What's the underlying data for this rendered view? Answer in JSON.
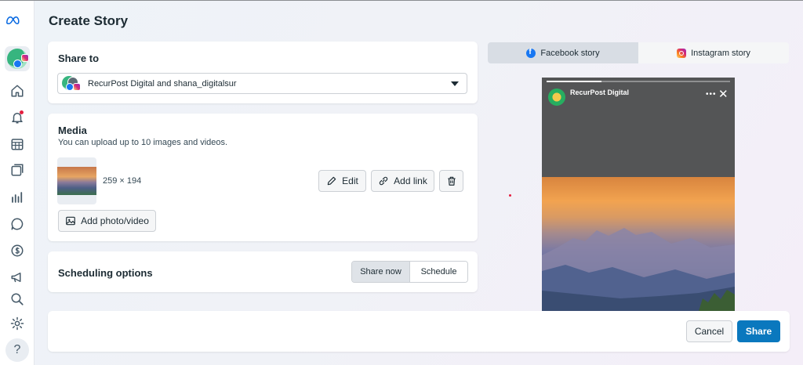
{
  "page": {
    "title": "Create Story"
  },
  "share_to": {
    "title": "Share to",
    "selected_accounts": "RecurPost Digital and shana_digitalsur"
  },
  "media": {
    "title": "Media",
    "subtitle": "You can upload up to 10 images and videos.",
    "item_dimensions": "259 × 194",
    "edit_label": "Edit",
    "add_link_label": "Add link",
    "add_photo_label": "Add photo/video"
  },
  "scheduling": {
    "title": "Scheduling options",
    "options": [
      "Share now",
      "Schedule"
    ],
    "selected": "Share now"
  },
  "preview": {
    "tabs": [
      {
        "label": "Facebook story",
        "icon": "facebook-icon",
        "active": true
      },
      {
        "label": "Instagram story",
        "icon": "instagram-icon",
        "active": false
      }
    ],
    "account_name": "RecurPost Digital",
    "more_label": "•••",
    "close_label": "✕"
  },
  "footer": {
    "cancel_label": "Cancel",
    "share_label": "Share"
  },
  "sidebar": {
    "icons": [
      "home-icon",
      "notifications-icon",
      "planner-icon",
      "content-icon",
      "insights-icon",
      "inbox-icon",
      "monetization-icon",
      "ads-icon",
      "search-icon",
      "settings-icon",
      "help-icon"
    ],
    "help_label": "?"
  },
  "colors": {
    "primary": "#0a78be",
    "facebook": "#1877f2",
    "notification": "#e41e3f"
  }
}
